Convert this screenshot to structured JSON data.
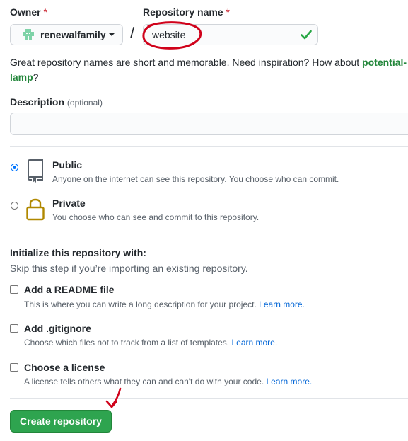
{
  "owner": {
    "label": "Owner",
    "required_mark": "*",
    "value": "renewalfamily"
  },
  "repo_name": {
    "label": "Repository name",
    "required_mark": "*",
    "value": "website",
    "separator": "/"
  },
  "hint": {
    "text": "Great repository names are short and memorable. Need inspiration? How about ",
    "suggestion": "potential-lamp",
    "suffix": "?"
  },
  "description": {
    "label": "Description",
    "optional": "(optional)"
  },
  "visibility": {
    "public": {
      "title": "Public",
      "desc": "Anyone on the internet can see this repository. You choose who can commit.",
      "selected": true
    },
    "private": {
      "title": "Private",
      "desc": "You choose who can see and commit to this repository.",
      "selected": false
    }
  },
  "init": {
    "title": "Initialize this repository with:",
    "subtitle": "Skip this step if you’re importing an existing repository.",
    "readme": {
      "title": "Add a README file",
      "desc": "This is where you can write a long description for your project.",
      "link": "Learn more."
    },
    "gitignore": {
      "title": "Add .gitignore",
      "desc": "Choose which files not to track from a list of templates.",
      "link": "Learn more."
    },
    "license": {
      "title": "Choose a license",
      "desc": "A license tells others what they can and can't do with your code.",
      "link": "Learn more."
    }
  },
  "submit": {
    "label": "Create repository"
  },
  "colors": {
    "primary_button": "#2ea44f",
    "valid_check": "#28a745",
    "link": "#0366d6",
    "suggestion": "#22863a",
    "annotation": "#d0021b"
  }
}
